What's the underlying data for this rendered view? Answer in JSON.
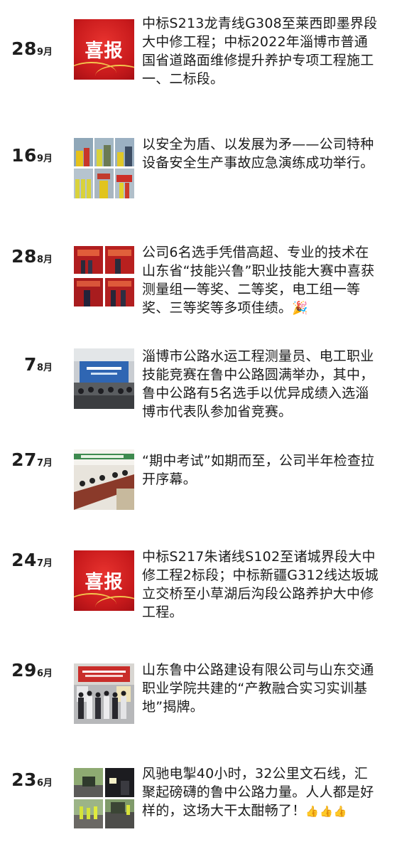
{
  "articles": [
    {
      "day": "28",
      "month": "9月",
      "thumb": "xibao",
      "title": "中标S213龙青线G308至莱西即墨界段大中修工程；中标2022年淄博市普通国省道路面维修提升养护专项工程施工一、二标段。"
    },
    {
      "day": "16",
      "month": "9月",
      "thumb": "photo-grid-safety-drill",
      "title": "以安全为盾、以发展为矛——公司特种设备安全生产事故应急演练成功举行。"
    },
    {
      "day": "28",
      "month": "8月",
      "thumb": "photo-grid-award-ceremony",
      "title": "公司6名选手凭借高超、专业的技术在山东省“技能兴鲁”职业技能大赛中喜获测量组一等奖、二等奖，电工组一等奖、三等奖等多项佳绩。",
      "emoji": "🎉"
    },
    {
      "day": "7",
      "month": "8月",
      "thumb": "photo-competition-stage",
      "title": "淄博市公路水运工程测量员、电工职业技能竞赛在鲁中公路圆满举办，其中，鲁中公路有5名选手以优异成绩入选淄博市代表队参加省竞赛。"
    },
    {
      "day": "27",
      "month": "7月",
      "thumb": "photo-meeting-room",
      "title": "“期中考试”如期而至，公司半年检查拉开序幕。"
    },
    {
      "day": "24",
      "month": "7月",
      "thumb": "xibao",
      "title": "中标S217朱诸线S102至诸城界段大中修工程2标段；中标新疆G312线达坂城立交桥至小草湖后沟段公路养护大中修工程。"
    },
    {
      "day": "29",
      "month": "6月",
      "thumb": "photo-plaque-unveiling",
      "title": "山东鲁中公路建设有限公司与山东交通职业学院共建的“产教融合实习实训基地”揭牌。"
    },
    {
      "day": "23",
      "month": "6月",
      "thumb": "photo-grid-road-work",
      "title": "风驰电掣40小时，32公里文石线，汇聚起磅礴的鲁中公路力量。人人都是好样的，这场大干太酣畅了！",
      "emoji": "👍👍👍"
    }
  ],
  "thumb_text": {
    "xibao": "喜报"
  },
  "colors": {
    "xibao_red": "#c81a1c",
    "xibao_gold": "#f4c64e",
    "text": "#1b1b1b",
    "background": "#ffffff"
  }
}
